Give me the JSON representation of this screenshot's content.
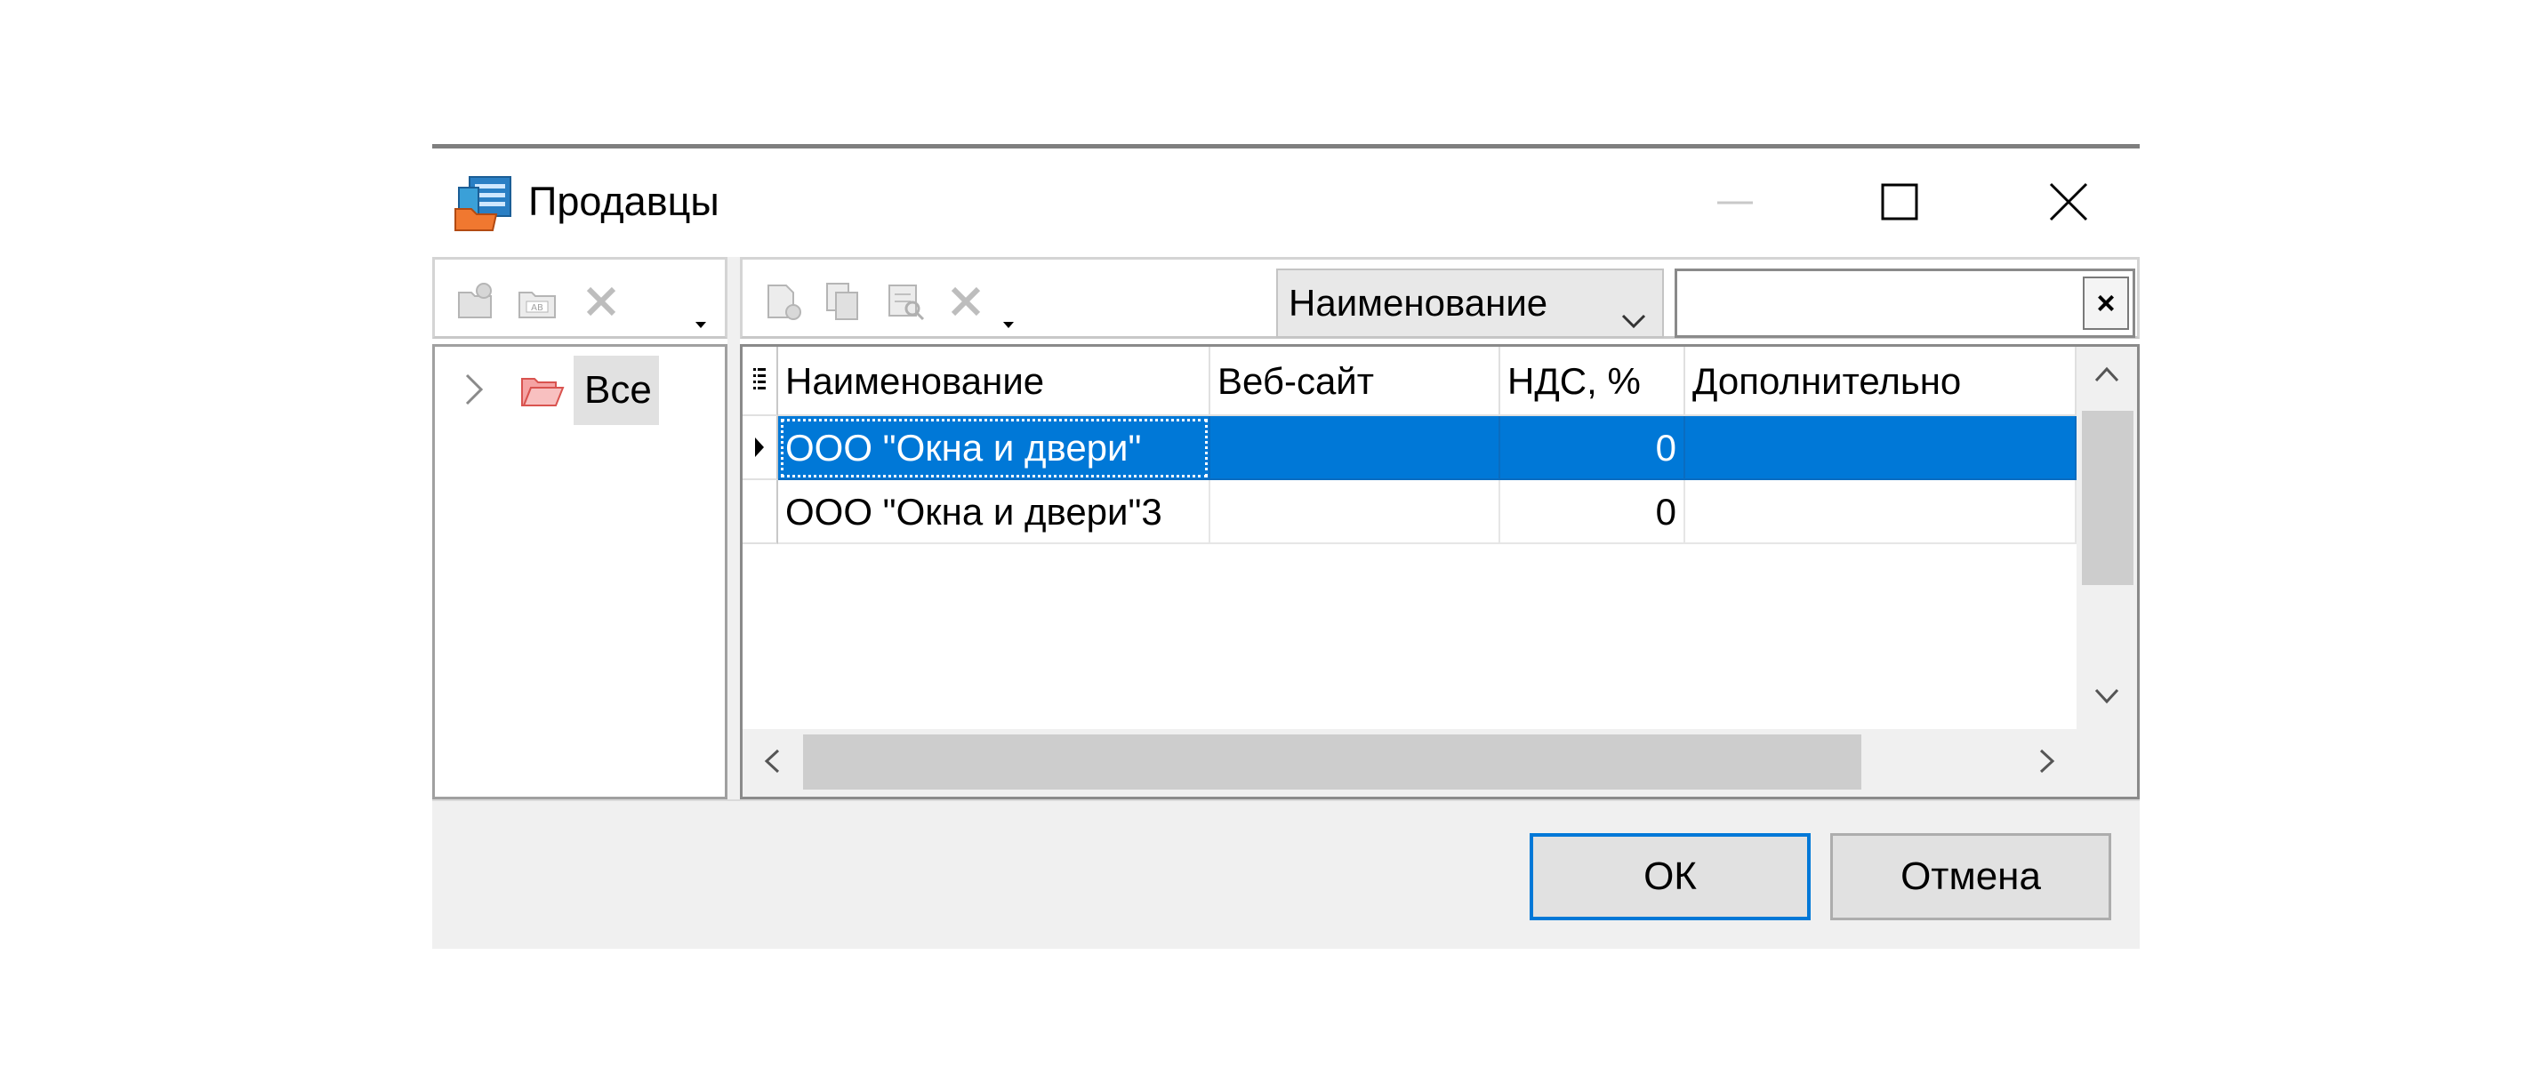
{
  "window": {
    "title": "Продавцы",
    "icons": {
      "app": "folder-list-icon",
      "minimize": "minimize-icon",
      "maximize": "maximize-icon",
      "close": "close-icon"
    }
  },
  "left_toolbar": {
    "icons": [
      "add-group-icon",
      "rename-icon",
      "delete-icon",
      "dropdown-arrow-icon"
    ]
  },
  "tree": {
    "items": [
      {
        "label": "Все",
        "icon": "open-folder-icon",
        "expanded": false
      }
    ]
  },
  "right_toolbar": {
    "icons": [
      "add-record-icon",
      "copy-record-icon",
      "edit-record-icon",
      "delete-icon",
      "dropdown-arrow-icon"
    ],
    "filter_field": {
      "selected": "Наименование"
    },
    "search": {
      "value": "",
      "clear_label": "×"
    }
  },
  "grid": {
    "columns": [
      "Наименование",
      "Веб-сайт",
      "НДС, %",
      "Дополнительно"
    ],
    "rows": [
      {
        "name": "ООО \"Окна и двери\"",
        "website": "",
        "vat": "0",
        "extra": "",
        "selected": true
      },
      {
        "name": "ООО \"Окна и двери\"3",
        "website": "",
        "vat": "0",
        "extra": "",
        "selected": false
      }
    ]
  },
  "footer": {
    "ok_label": "ОК",
    "cancel_label": "Отмена"
  },
  "colors": {
    "selection": "#0078d7",
    "frame": "#8a8a8a",
    "footer_bg": "#f0f0f0"
  }
}
